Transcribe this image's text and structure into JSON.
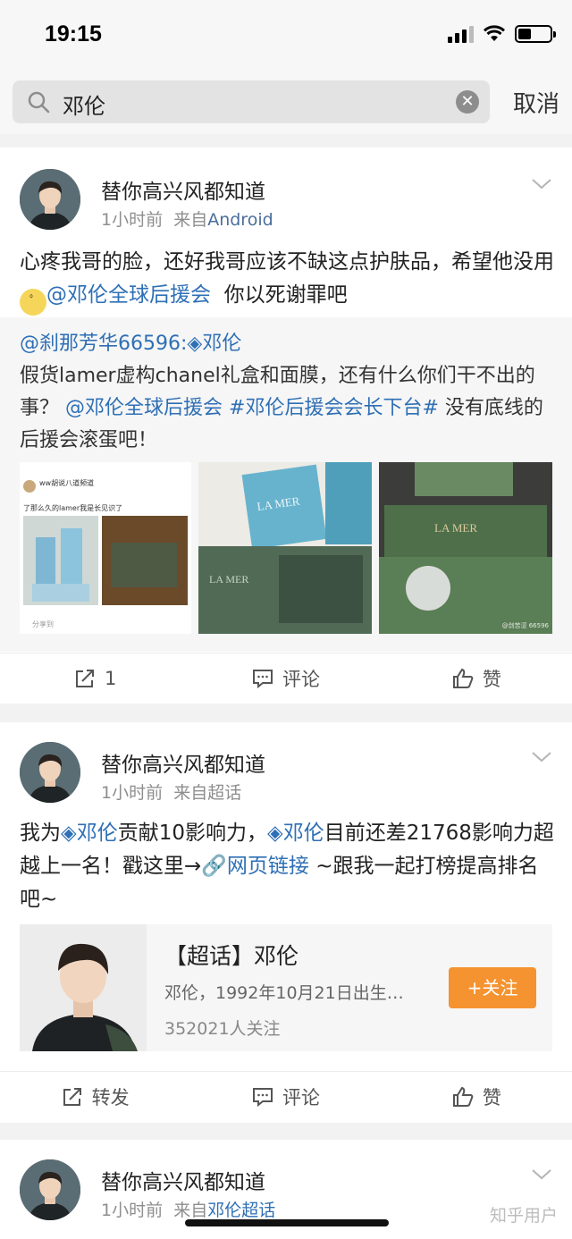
{
  "status": {
    "time": "19:15"
  },
  "search": {
    "query": "邓伦",
    "cancel": "取消"
  },
  "posts": [
    {
      "user": "替你高兴风都知道",
      "time": "1小时前",
      "from": "来自",
      "source": "Android",
      "text_a": "心疼我哥的脸，还好我哥应该不缺这点护肤品，希望他没用",
      "mention": "@邓伦全球后援会",
      "text_b": "你以死谢罪吧",
      "repost": {
        "author": "@刹那芳华66596:",
        "topic": "邓伦",
        "text_a": "假货lamer虚构chanel礼盒和面膜，还有什么你们干不出的事？",
        "mention": "@邓伦全球后援会",
        "hashtag": "#邓伦后援会会长下台#",
        "text_b": "没有底线的后援会滚蛋吧！",
        "images": [
          {
            "user": "ww胡说八道频道",
            "caption": "了那么久的lamer我是长见识了",
            "share": "分享到"
          },
          {
            "brand": "LA MER"
          },
          {
            "brand": "LA MER"
          },
          {
            "brand": "LA MER",
            "credit": "@剑苦涩 66596"
          }
        ]
      },
      "actions": {
        "repost": "1",
        "comment": "评论",
        "like": "赞"
      }
    },
    {
      "user": "替你高兴风都知道",
      "time": "1小时前",
      "from": "来自",
      "source": "超话",
      "text_a": "我为",
      "topic1": "邓伦",
      "text_b": "贡献10影响力，",
      "topic2": "邓伦",
      "text_c": "目前还差21768影响力超越上一名！戳这里→",
      "weblink": "网页链接",
      "text_d": "~跟我一起打榜提高排名吧~",
      "topic_card": {
        "title": "【超话】邓伦",
        "desc": "邓伦，1992年10月21日出生…",
        "followers": "352021人关注",
        "follow_btn": "+关注"
      },
      "actions": {
        "repost": "转发",
        "comment": "评论",
        "like": "赞"
      }
    },
    {
      "user": "替你高兴风都知道",
      "time": "1小时前",
      "from": "来自",
      "source": "邓伦超话"
    }
  ],
  "watermark": "知乎用户"
}
